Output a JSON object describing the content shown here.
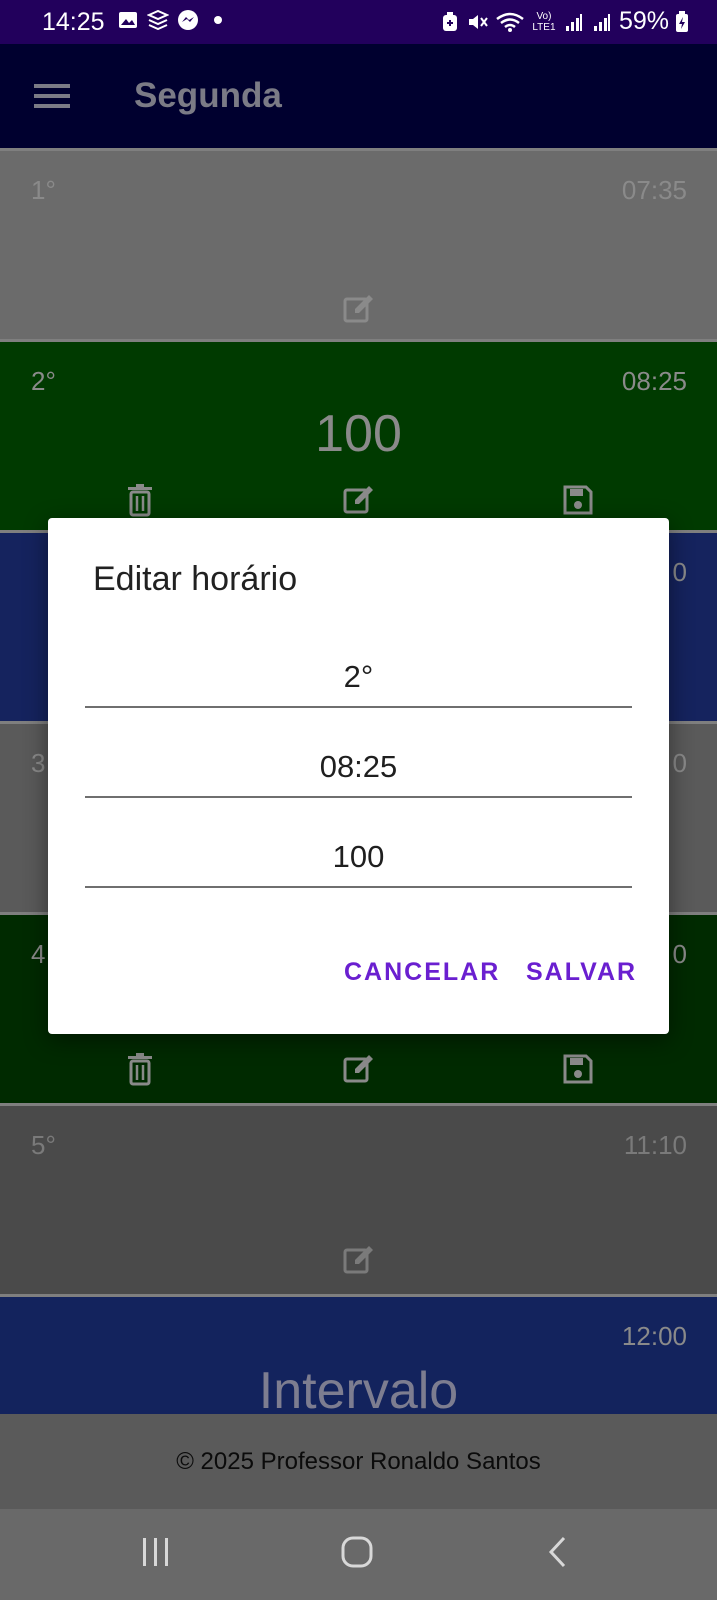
{
  "status_bar": {
    "time": "14:25",
    "battery": "59%",
    "network": "Vo) LTE1",
    "left_icons": [
      "image-icon",
      "stack-icon",
      "messenger-icon",
      "dot-icon"
    ],
    "right_icons": [
      "sync-icon",
      "mute-icon",
      "wifi-icon",
      "signal-icon",
      "signal-icon",
      "battery-icon"
    ]
  },
  "app_bar": {
    "title": "Segunda"
  },
  "rows": [
    {
      "period": "1°",
      "time": "07:35",
      "content": "",
      "color": "#6b6b6b"
    },
    {
      "period": "2°",
      "time": "08:25",
      "content": "100",
      "color": "#003a00"
    },
    {
      "period": "",
      "time": "0",
      "content": "",
      "color": "#15235e"
    },
    {
      "period": "3",
      "time": "0",
      "content": "",
      "color": "#5a5a5a"
    },
    {
      "period": "4",
      "time": "0",
      "content": "",
      "color": "#002a00"
    },
    {
      "period": "5°",
      "time": "11:10",
      "content": "",
      "color": "#4a4a4a"
    },
    {
      "period": "",
      "time": "12:00",
      "content": "Intervalo",
      "color": "#13235d"
    }
  ],
  "dialog": {
    "title": "Editar horário",
    "fields": [
      {
        "name": "period",
        "value": "2°"
      },
      {
        "name": "time",
        "value": "08:25"
      },
      {
        "name": "content",
        "value": "100"
      }
    ],
    "cancel_label": "CANCELAR",
    "save_label": "SALVAR"
  },
  "footer": {
    "text": "© 2025 Professor Ronaldo Santos"
  },
  "colors": {
    "status_bar": "#22005c",
    "app_bar": "#00002f",
    "accent": "#6a1fd0",
    "dim_text": "#8a8a8a"
  }
}
